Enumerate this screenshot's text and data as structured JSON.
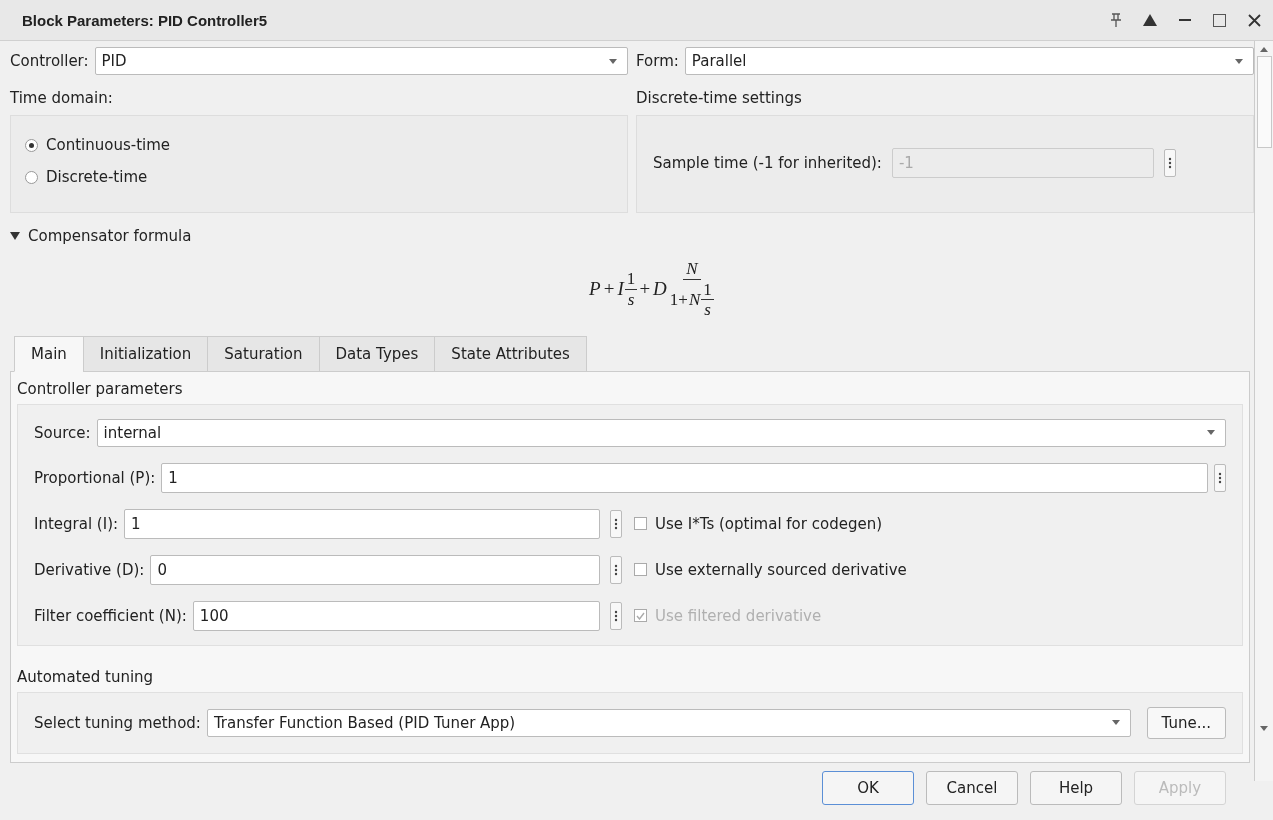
{
  "window": {
    "title": "Block Parameters: PID Controller5"
  },
  "controller": {
    "label": "Controller:",
    "value": "PID"
  },
  "form": {
    "label": "Form:",
    "value": "Parallel"
  },
  "time_domain": {
    "label": "Time domain:",
    "options": [
      {
        "label": "Continuous-time",
        "selected": true
      },
      {
        "label": "Discrete-time",
        "selected": false
      }
    ]
  },
  "discrete_settings": {
    "label": "Discrete-time settings",
    "sample_time": {
      "label": "Sample time (-1 for inherited):",
      "value": "-1",
      "disabled": true
    }
  },
  "compensator": {
    "label": "Compensator formula",
    "expanded": true,
    "formula": [
      {
        "kind": "sym",
        "text": "P"
      },
      {
        "kind": "op",
        "text": "+"
      },
      {
        "kind": "sym",
        "text": "I"
      },
      {
        "kind": "frac",
        "num": [
          {
            "kind": "num",
            "text": "1"
          }
        ],
        "den": [
          {
            "kind": "sym",
            "text": "s"
          }
        ]
      },
      {
        "kind": "op",
        "text": "+"
      },
      {
        "kind": "sym",
        "text": "D"
      },
      {
        "kind": "frac",
        "num": [
          {
            "kind": "sym",
            "text": "N"
          }
        ],
        "den": [
          {
            "kind": "num",
            "text": "1+"
          },
          {
            "kind": "sym",
            "text": "N"
          },
          {
            "kind": "frac",
            "num": [
              {
                "kind": "num",
                "text": "1"
              }
            ],
            "den": [
              {
                "kind": "sym",
                "text": "s"
              }
            ]
          }
        ]
      }
    ]
  },
  "tabs": [
    {
      "label": "Main",
      "selected": true
    },
    {
      "label": "Initialization",
      "selected": false
    },
    {
      "label": "Saturation",
      "selected": false
    },
    {
      "label": "Data Types",
      "selected": false
    },
    {
      "label": "State Attributes",
      "selected": false
    }
  ],
  "controller_parameters": {
    "label": "Controller parameters",
    "source": {
      "label": "Source:",
      "value": "internal"
    },
    "proportional": {
      "label": "Proportional (P):",
      "value": "1"
    },
    "rows": [
      {
        "label": "Integral (I):",
        "value": "1",
        "option": {
          "label": "Use I*Ts (optimal for codegen)",
          "checked": false,
          "disabled": false
        }
      },
      {
        "label": "Derivative (D):",
        "value": "0",
        "option": {
          "label": "Use externally sourced derivative",
          "checked": false,
          "disabled": false
        }
      },
      {
        "label": "Filter coefficient (N):",
        "value": "100",
        "option": {
          "label": "Use filtered derivative",
          "checked": true,
          "disabled": true
        }
      }
    ]
  },
  "automated_tuning": {
    "label": "Automated tuning",
    "method": {
      "label": "Select tuning method:",
      "value": "Transfer Function Based (PID Tuner App)"
    },
    "tune_button": "Tune..."
  },
  "buttons": [
    {
      "label": "OK",
      "default": true,
      "disabled": false
    },
    {
      "label": "Cancel",
      "default": false,
      "disabled": false
    },
    {
      "label": "Help",
      "default": false,
      "disabled": false
    },
    {
      "label": "Apply",
      "default": false,
      "disabled": true
    }
  ]
}
